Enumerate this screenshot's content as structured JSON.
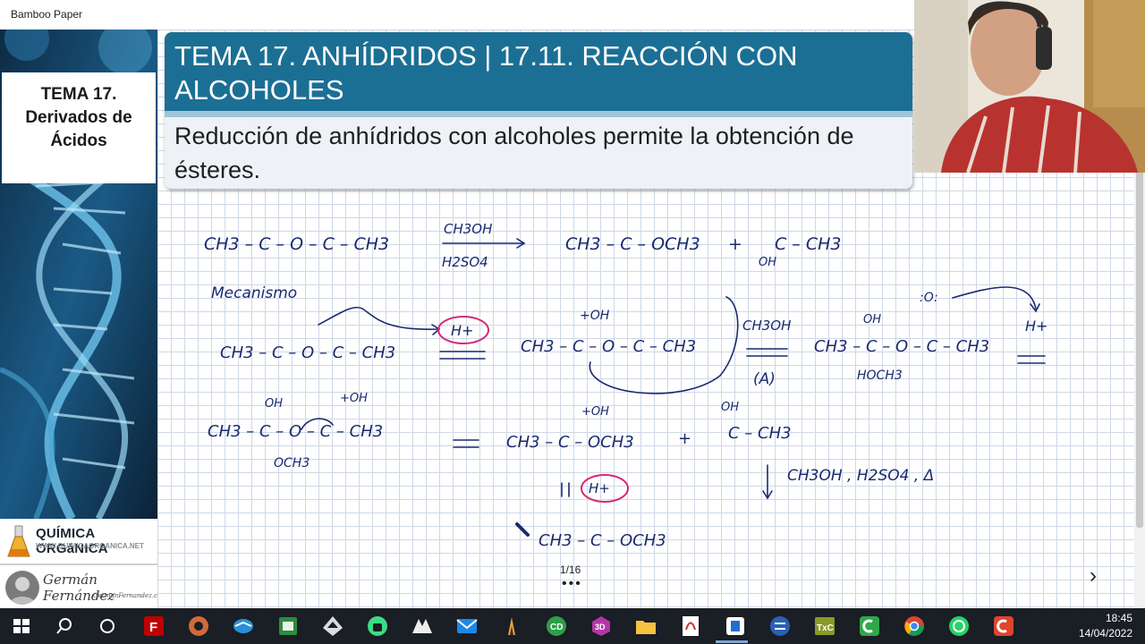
{
  "window": {
    "title": "Bamboo Paper"
  },
  "sidebar": {
    "topic_lines": [
      "TEMA 17.",
      "Derivados de",
      "Ácidos"
    ],
    "brand_name": "QUÍMICA ORGáNICA",
    "brand_url": "WWW.QUIMICAORGANICA.NET",
    "signature": "Germán Fernández",
    "signature_sub": "GermanFernandez.com"
  },
  "slide": {
    "title": "TEMA 17. ANHÍDRIDOS | 17.11. REACCIÓN CON ALCOHOLES",
    "subtitle": "Reducción de anhídridos con alcoholes permite la obtención de ésteres."
  },
  "handwriting": {
    "reactant": "CH3 – C – O – C – CH3",
    "reagent_top": "CH3OH",
    "reagent_bottom": "H2SO4",
    "product_ester": "CH3 – C – OCH3",
    "plus1": "+",
    "product_acid": "C – CH3",
    "acid_oh": "OH",
    "mechanism": "Mecanismo",
    "mech1": "CH3 – C – O – C – CH3",
    "hplus1": "H+",
    "mech2": "CH3 – C – O – C – CH3",
    "mech2_oh": "+OH",
    "methanol": "CH3OH",
    "label_a": "(A)",
    "mech3": "CH3 – C – O – C – CH3",
    "mech3_oh": "OH",
    "mech3_o": ":O:",
    "mech3_hoch3": "HOCH3",
    "hplus2": "H+",
    "mech4": "CH3 – C – O – C – CH3",
    "mech4_oh": "OH",
    "mech4_oh2": "+OH",
    "mech4_och3": "OCH3",
    "mech5": "CH3 – C – OCH3",
    "mech5_oh": "+OH",
    "plus2": "+",
    "mech6": "C – CH3",
    "mech6_oh": "OH",
    "hplus3": "H+",
    "conditions": "CH3OH , H2SO4 , Δ",
    "final": "CH3 – C – OCH3"
  },
  "footer": {
    "page": "1/16",
    "dots": "•••"
  },
  "taskbar": {
    "time": "18:45",
    "date": "14/04/2022",
    "icons": [
      "windows-icon",
      "search-icon",
      "task-view-icon",
      "filezilla-icon",
      "media-icon",
      "bluefish-icon",
      "excel-icon",
      "inkscape-icon",
      "android-icon",
      "sharpdevelop-icon",
      "mail-icon",
      "pen-icon",
      "cd-icon",
      "3d-icon",
      "folder-icon",
      "pdf-icon",
      "bamboo-icon",
      "eclipse-icon",
      "texcommander-icon",
      "camtasia-icon",
      "chrome-icon",
      "whatsapp-icon",
      "camtasia-red-icon"
    ]
  }
}
